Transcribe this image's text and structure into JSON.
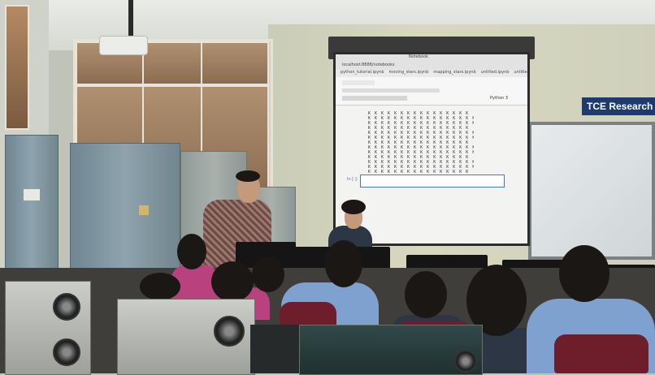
{
  "scene": {
    "sign_text": "TCE Research L",
    "screen": {
      "browser_title": "Notebook",
      "address": "localhost:8888/notebooks",
      "bookmarks": [
        "python_tutorial.ipynb",
        "moving_stars.ipynb",
        "mapping_stars.ipynb",
        "untitled.ipynb",
        "untitled.ipynb"
      ],
      "toolbar_right": "Python 3",
      "prompt_label": "In [ ]:",
      "kernel_rows": 13,
      "pattern_char": "K"
    }
  },
  "colors": {
    "sign_bg": "#1f3b6e",
    "cell_border": "#4a78c8",
    "chair": "#6e1e2a"
  }
}
